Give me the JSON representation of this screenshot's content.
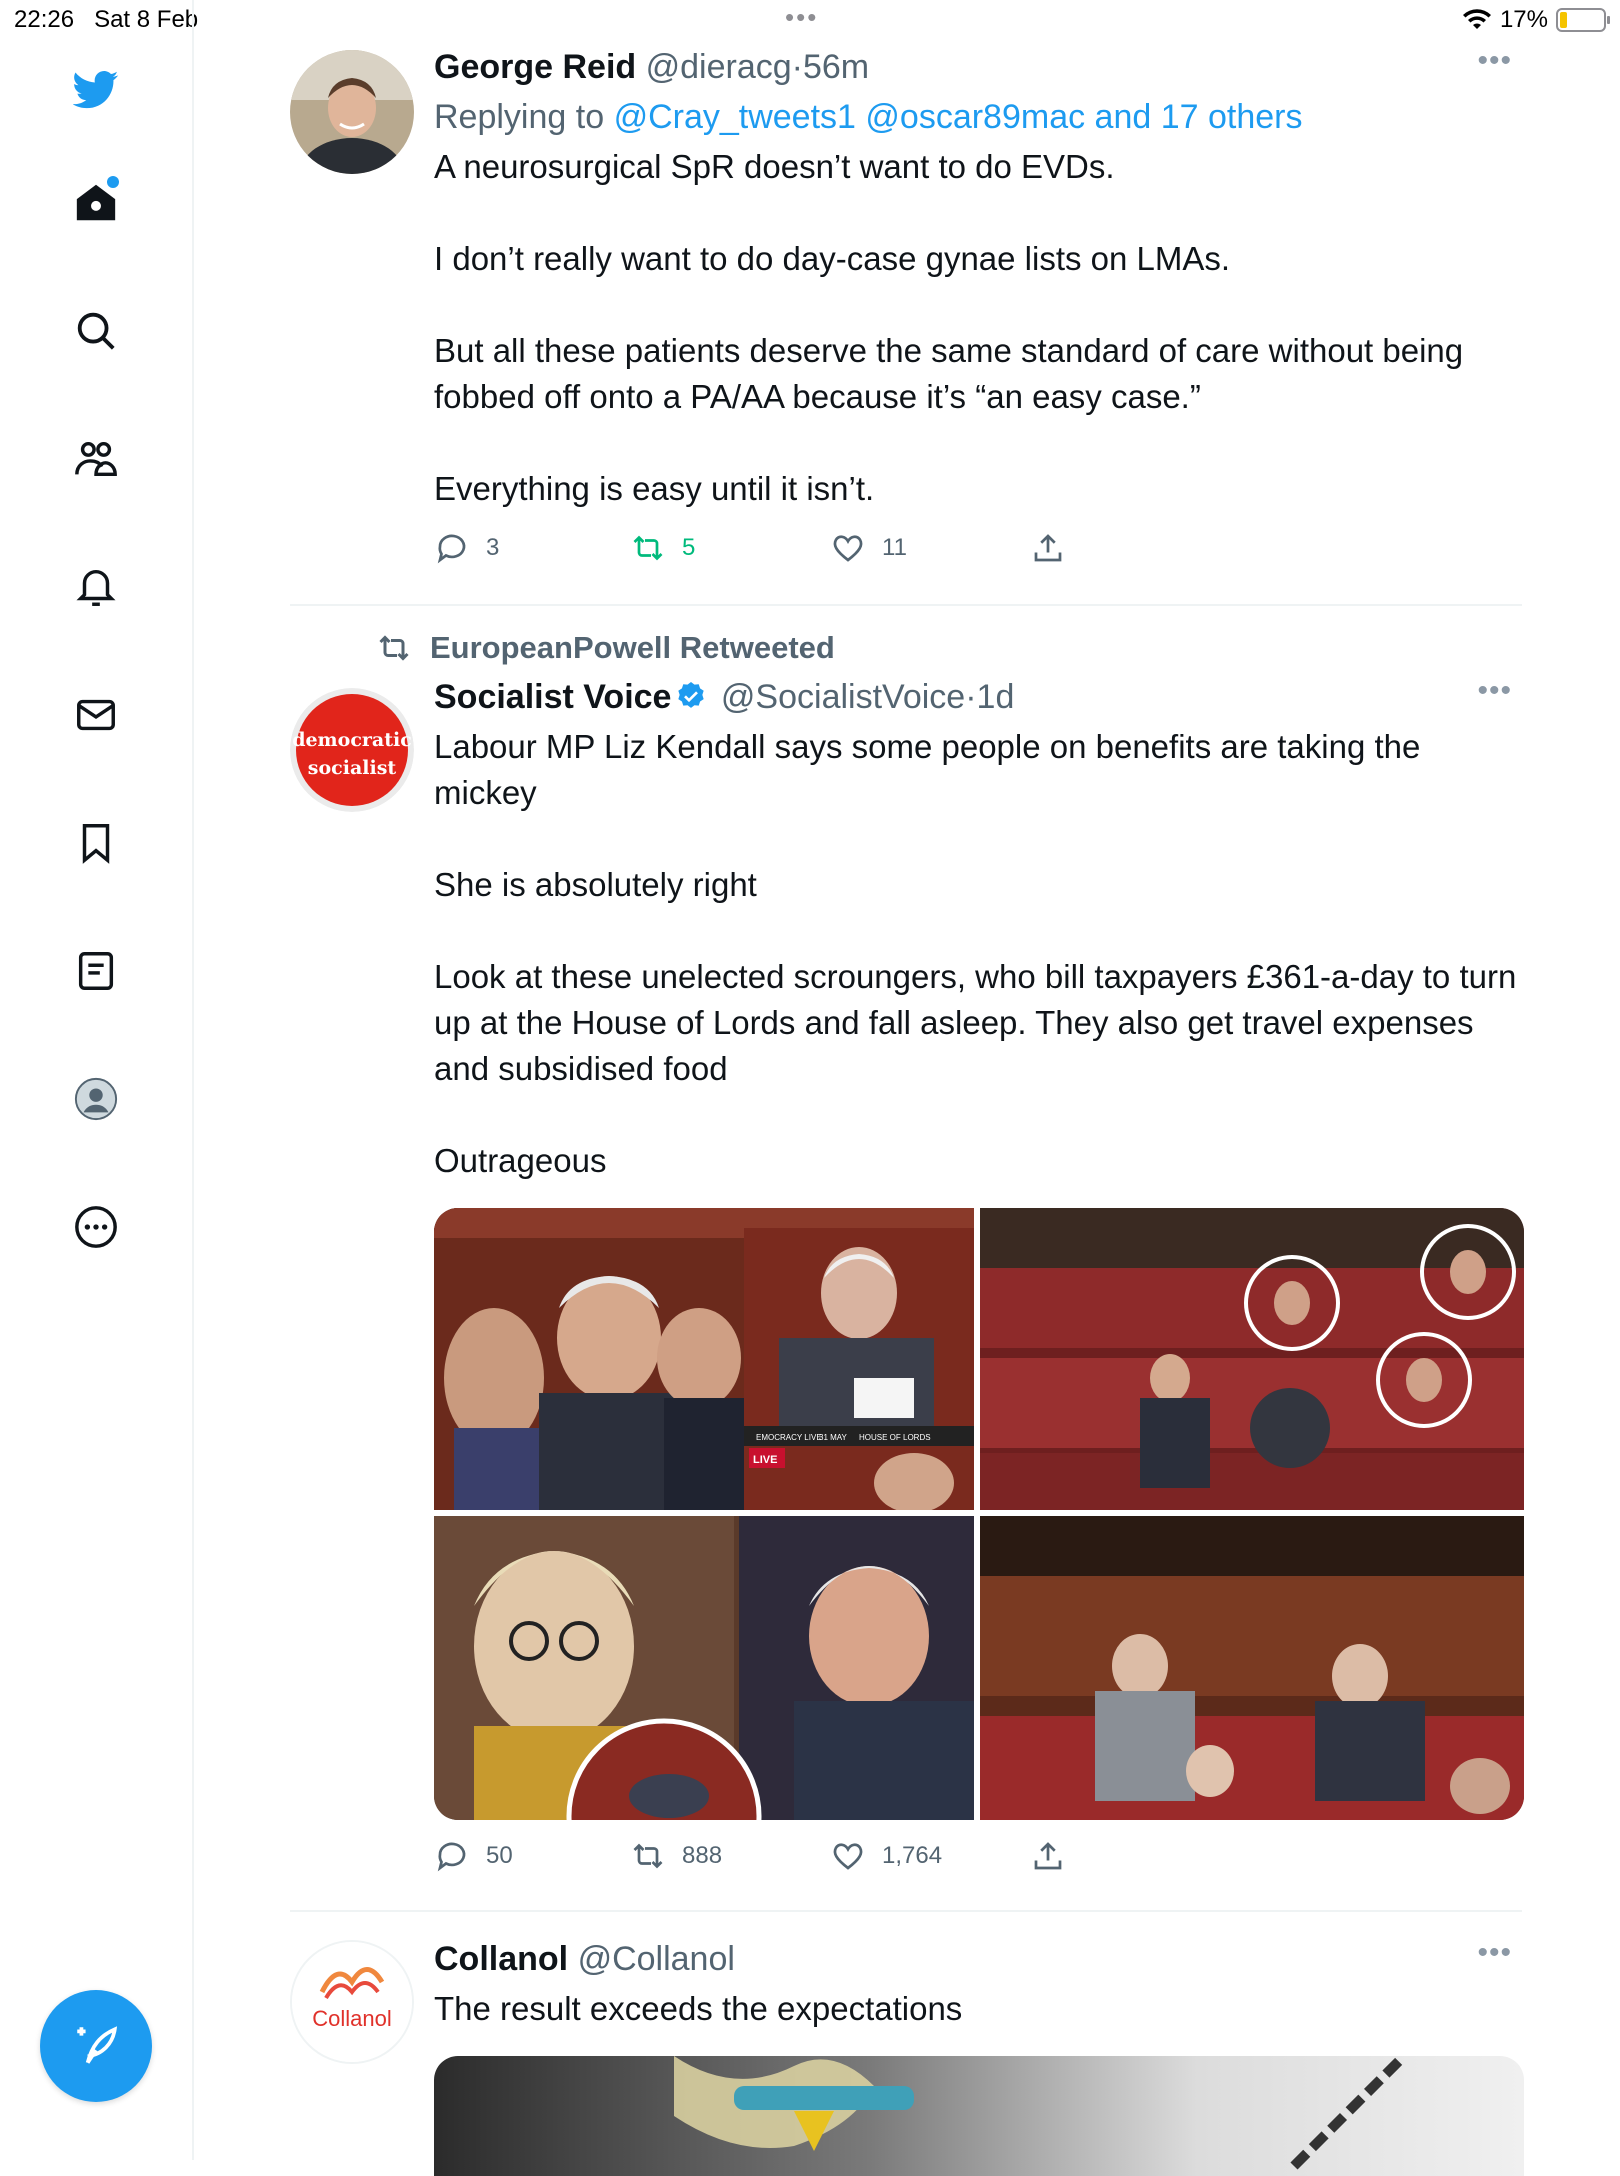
{
  "status_bar": {
    "time": "22:26",
    "date": "Sat 8 Feb",
    "battery": "17%",
    "battery_level": 0.17
  },
  "sidebar": {
    "items": [
      {
        "name": "twitter-logo",
        "interactable": true
      },
      {
        "name": "home",
        "interactable": true
      },
      {
        "name": "explore",
        "interactable": true
      },
      {
        "name": "communities",
        "interactable": true
      },
      {
        "name": "notifications",
        "interactable": true
      },
      {
        "name": "messages",
        "interactable": true
      },
      {
        "name": "bookmarks",
        "interactable": true
      },
      {
        "name": "lists",
        "interactable": true
      },
      {
        "name": "profile",
        "interactable": true
      },
      {
        "name": "more",
        "interactable": true
      }
    ],
    "compose_icon": "feather-plus-icon"
  },
  "tweets": [
    {
      "name": "George Reid",
      "handle": "@dieracg",
      "sep": "·",
      "time": "56m",
      "replying_prefix": "Replying to",
      "replying_to": "@Cray_tweets1 @oscar89mac and 17 others",
      "text": "A neurosurgical SpR doesn’t want to do EVDs.\n\nI don’t really want to do day-case gynae lists on LMAs.\n\nBut all these patients deserve the same standard of care without being fobbed off onto a PA/AA because it’s “an easy case.”\n\nEverything is easy until it isn’t.",
      "replies": "3",
      "retweets": "5",
      "likes": "11"
    },
    {
      "retweeted_by": "EuropeanPowell Retweeted",
      "name": "Socialist Voice",
      "handle": "@SocialistVoice",
      "sep": "·",
      "time": "1d",
      "avatar_text_1": "democratic",
      "avatar_text_2": "socialist",
      "text": "Labour MP Liz Kendall says some people on benefits are taking the mickey\n\nShe is absolutely right\n\nLook at these unelected scroungers, who bill taxpayers £361-a-day to turn up at the House of Lords and fall asleep. They also get travel expenses and subsidised food\n\nOutrageous",
      "media_caption_1": "EMOCRACY LIVE",
      "media_caption_2": "31 MAY",
      "media_caption_3": "HOUSE OF LORDS",
      "media_live": "LIVE",
      "replies": "50",
      "retweets": "888",
      "likes": "1,764"
    },
    {
      "name": "Collanol",
      "handle": "@Collanol",
      "avatar_text": "Collanol",
      "text": "The result exceeds the expectations"
    }
  ]
}
